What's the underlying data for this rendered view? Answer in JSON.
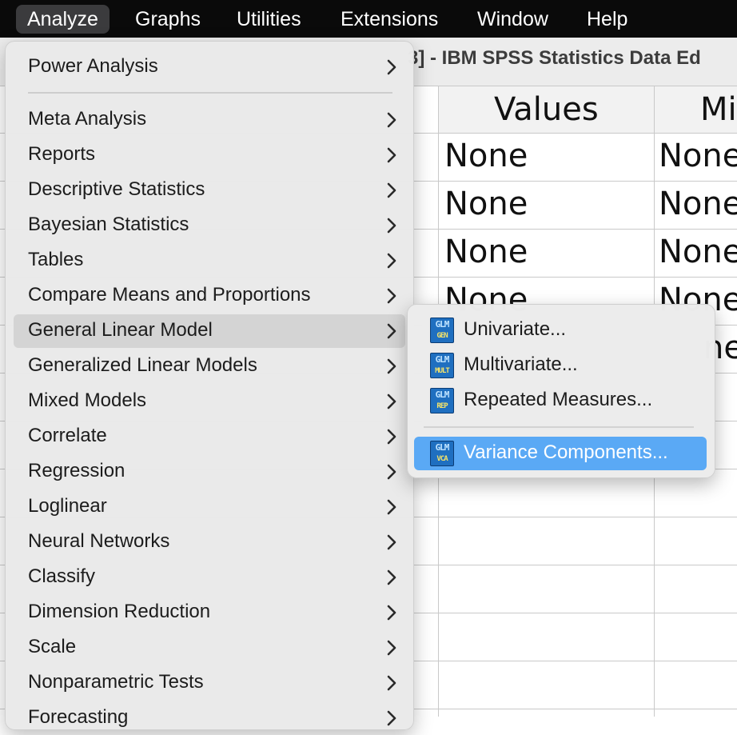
{
  "menubar": {
    "items": [
      "Analyze",
      "Graphs",
      "Utilities",
      "Extensions",
      "Window",
      "Help"
    ],
    "active": "Analyze"
  },
  "window": {
    "title": "3] - IBM SPSS Statistics Data Ed"
  },
  "grid": {
    "columns": [
      "Values",
      "Mi"
    ],
    "rows": [
      [
        "None",
        "None"
      ],
      [
        "None",
        "None"
      ],
      [
        "None",
        "None"
      ],
      [
        "None",
        "None"
      ],
      [
        "",
        "ne"
      ]
    ]
  },
  "analyze_menu": {
    "items": [
      {
        "label": "Power Analysis"
      },
      {
        "label": "Meta Analysis"
      },
      {
        "label": "Reports"
      },
      {
        "label": "Descriptive Statistics"
      },
      {
        "label": "Bayesian Statistics"
      },
      {
        "label": "Tables"
      },
      {
        "label": "Compare Means and Proportions"
      },
      {
        "label": "General Linear Model"
      },
      {
        "label": "Generalized Linear Models"
      },
      {
        "label": "Mixed Models"
      },
      {
        "label": "Correlate"
      },
      {
        "label": "Regression"
      },
      {
        "label": "Loglinear"
      },
      {
        "label": "Neural Networks"
      },
      {
        "label": "Classify"
      },
      {
        "label": "Dimension Reduction"
      },
      {
        "label": "Scale"
      },
      {
        "label": "Nonparametric Tests"
      },
      {
        "label": "Forecasting"
      }
    ],
    "highlighted": "General Linear Model"
  },
  "glm_submenu": {
    "items": [
      {
        "label": "Univariate...",
        "icon": "glm-gen-icon",
        "icon_top": "GLM",
        "icon_bottom": "GEN"
      },
      {
        "label": "Multivariate...",
        "icon": "glm-mult-icon",
        "icon_top": "GLM",
        "icon_bottom": "MULT"
      },
      {
        "label": "Repeated Measures...",
        "icon": "glm-rep-icon",
        "icon_top": "GLM",
        "icon_bottom": "REP"
      },
      {
        "label": "Variance Components...",
        "icon": "glm-vca-icon",
        "icon_top": "GLM",
        "icon_bottom": "VCA"
      }
    ],
    "selected": "Variance Components..."
  },
  "colors": {
    "menubar_bg": "#0a0a0a",
    "menu_highlight": "#d4d4d4",
    "selection_blue": "#5aa9f5"
  }
}
